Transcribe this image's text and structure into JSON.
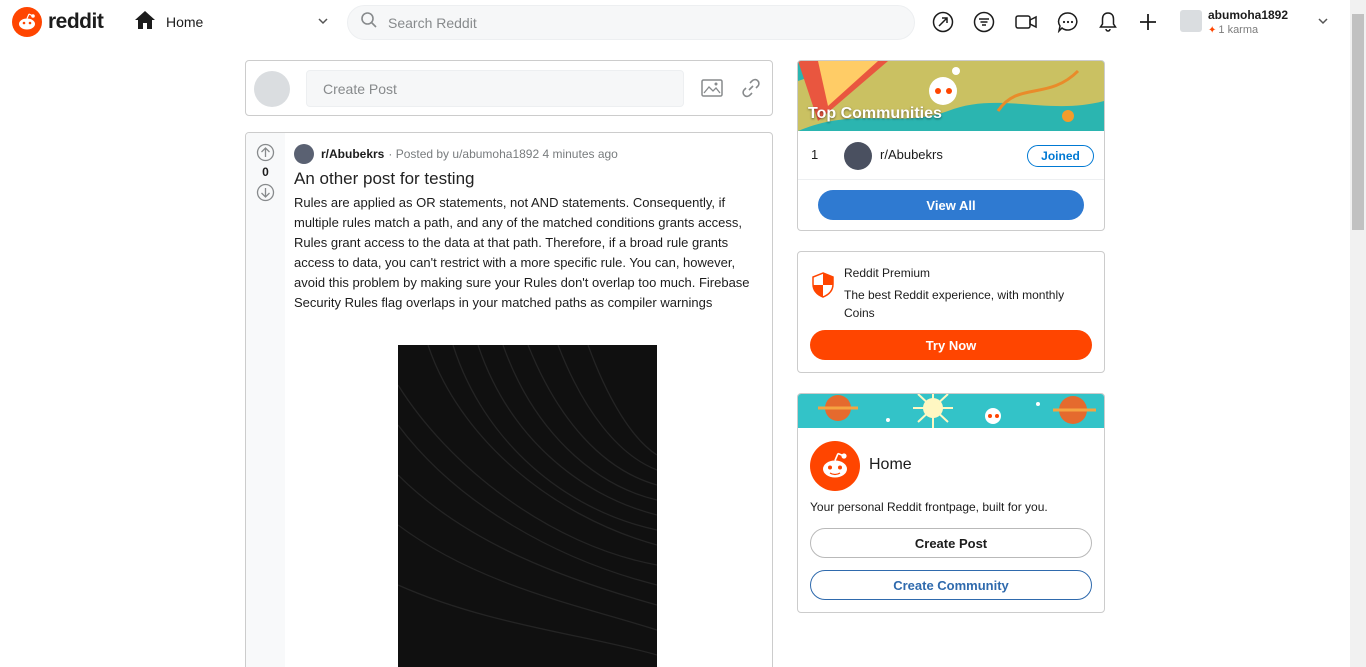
{
  "header": {
    "logo_text": "reddit",
    "feed_label": "Home",
    "search_placeholder": "Search Reddit",
    "icons": [
      "popular-icon",
      "feed-filter-icon",
      "video-icon",
      "chat-icon",
      "notification-bell-icon",
      "create-plus-icon"
    ],
    "user": {
      "name": "abumoha1892",
      "karma": "1 karma"
    }
  },
  "create_post": {
    "placeholder": "Create Post"
  },
  "post": {
    "score": "0",
    "subreddit": "r/Abubekrs",
    "posted_by": "· Posted by u/abumoha1892 4 minutes ago",
    "title": "An other post for testing",
    "body": "Rules are applied as OR statements, not AND statements. Consequently, if multiple rules match a path, and any of the matched conditions grants access, Rules grant access to the data at that path. Therefore, if a broad rule grants access to data, you can't restrict with a more specific rule. You can, however, avoid this problem by making sure your Rules don't overlap too much. Firebase Security Rules flag overlaps in your matched paths as compiler warnings"
  },
  "top_communities": {
    "title": "Top Communities",
    "items": [
      {
        "rank": "1",
        "name": "r/Abubekrs",
        "status": "Joined"
      }
    ],
    "view_all": "View All"
  },
  "premium": {
    "title": "Reddit Premium",
    "description": "The best Reddit experience, with monthly Coins",
    "button": "Try Now"
  },
  "home_card": {
    "title": "Home",
    "description": "Your personal Reddit frontpage, built for you.",
    "create_post": "Create Post",
    "create_community": "Create Community"
  },
  "colors": {
    "brand": "#ff4500",
    "accent": "#0079d3"
  }
}
